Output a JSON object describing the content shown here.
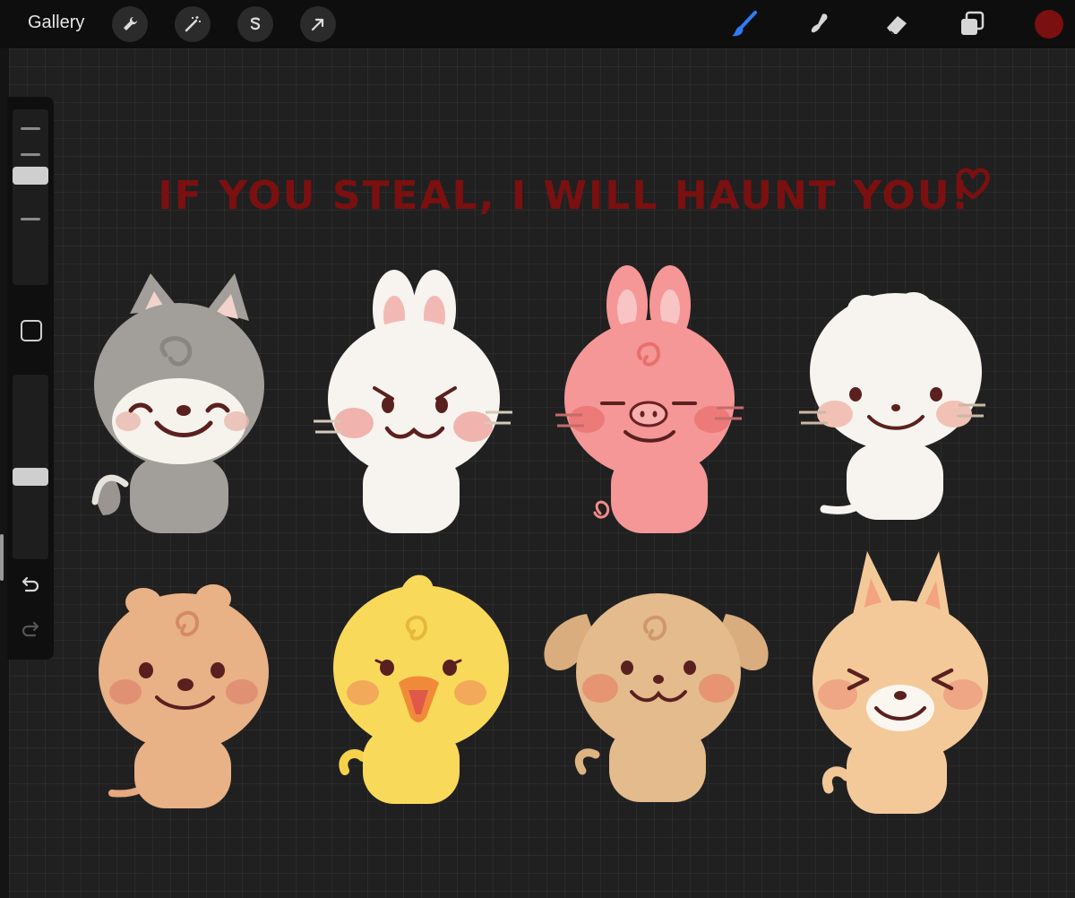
{
  "toolbar": {
    "gallery_label": "Gallery",
    "left_tools": [
      "wrench-icon",
      "magic-wand-icon",
      "selection-s-icon",
      "transform-arrow-icon"
    ],
    "right_tools": [
      "brush-icon",
      "smudge-icon",
      "eraser-icon",
      "layers-icon"
    ],
    "active_tool": "brush-icon",
    "active_color": "#7a1010",
    "accent": "#2f7cf6"
  },
  "sidebar": {
    "brush_size": 0.25,
    "opacity": 0.55,
    "modify_button": "square-icon",
    "undo": "undo-icon",
    "redo": "redo-icon"
  },
  "artwork": {
    "caption": "IF YOU STEAL, I WILL HAUNT YOU!",
    "caption_color": "#7a1010",
    "characters": [
      "wolf",
      "rabbit",
      "pig",
      "cat",
      "quokka",
      "chick",
      "puppy",
      "fox"
    ]
  }
}
